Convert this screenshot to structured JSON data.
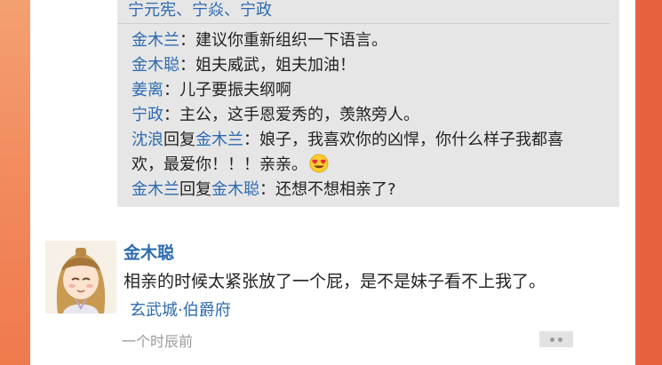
{
  "comments": {
    "likes_text": "宁元宪、宁焱、宁政",
    "replies": [
      {
        "author": "金木兰",
        "separator": "：",
        "text": "建议你重新组织一下语言。"
      },
      {
        "author": "金木聪",
        "separator": "：",
        "text": "姐夫威武，姐夫加油！"
      },
      {
        "author": "姜离",
        "separator": "：",
        "text": "儿子要振夫纲啊"
      },
      {
        "author": "宁政",
        "separator": "：",
        "text": "主公，这手恩爱秀的，羡煞旁人。"
      },
      {
        "author": "沈浪",
        "reply_word": "回复",
        "reply_to": "金木兰",
        "separator": "：",
        "text_line1": "娘子，我喜欢你的凶悍，你什么样子我都喜",
        "text_line2": "欢，最爱你！！！亲亲。",
        "emoji": "heart-eyes-emoji"
      },
      {
        "author": "金木兰",
        "reply_word": "回复",
        "reply_to": "金木聪",
        "separator": "：",
        "text": "还想不想相亲了?"
      }
    ]
  },
  "post": {
    "author": "金木聪",
    "text": "相亲的时候太紧张放了一个屁，是不是妹子看不上我了。",
    "location": "玄武城·伯爵府",
    "time": "一个时辰前",
    "more_icon": "more-dots-icon"
  },
  "colors": {
    "link": "#2e6bb0",
    "background_orange": "#f07a50",
    "comment_box": "#e6e6e6"
  }
}
